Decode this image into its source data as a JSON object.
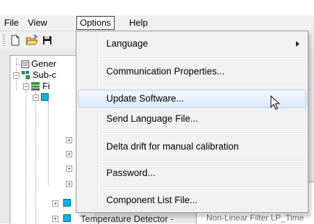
{
  "menubar": {
    "items": [
      {
        "label": "File"
      },
      {
        "label": "View"
      },
      {
        "label": "Options"
      },
      {
        "label": "Help"
      }
    ]
  },
  "toolbar": {
    "buttons": [
      "new-file-icon",
      "open-folder-icon",
      "save-icon"
    ]
  },
  "tree": {
    "items": [
      {
        "label": "Gener",
        "icon": "general-icon"
      },
      {
        "label": "Sub-c",
        "icon": "subsystem-icon"
      },
      {
        "label": "Fi",
        "icon": "filter-icon"
      }
    ],
    "bottom_label": "Temperature Detector -"
  },
  "background_panel": {
    "text": "Non-Linear Filter LP_Time"
  },
  "options_menu": {
    "items": [
      {
        "label": "Language",
        "has_submenu": true
      },
      {
        "label": "Communication Properties..."
      },
      {
        "label": "Update Software...",
        "highlighted": true
      },
      {
        "label": "Send Language File..."
      },
      {
        "label": "Delta drift for manual calibration"
      },
      {
        "label": "Password..."
      },
      {
        "label": "Component List File..."
      }
    ]
  },
  "colors": {
    "menu_highlight_border": "#aecff7",
    "tree_node_cyan": "#00b4e6",
    "tree_node_green": "#2e9a3e"
  }
}
